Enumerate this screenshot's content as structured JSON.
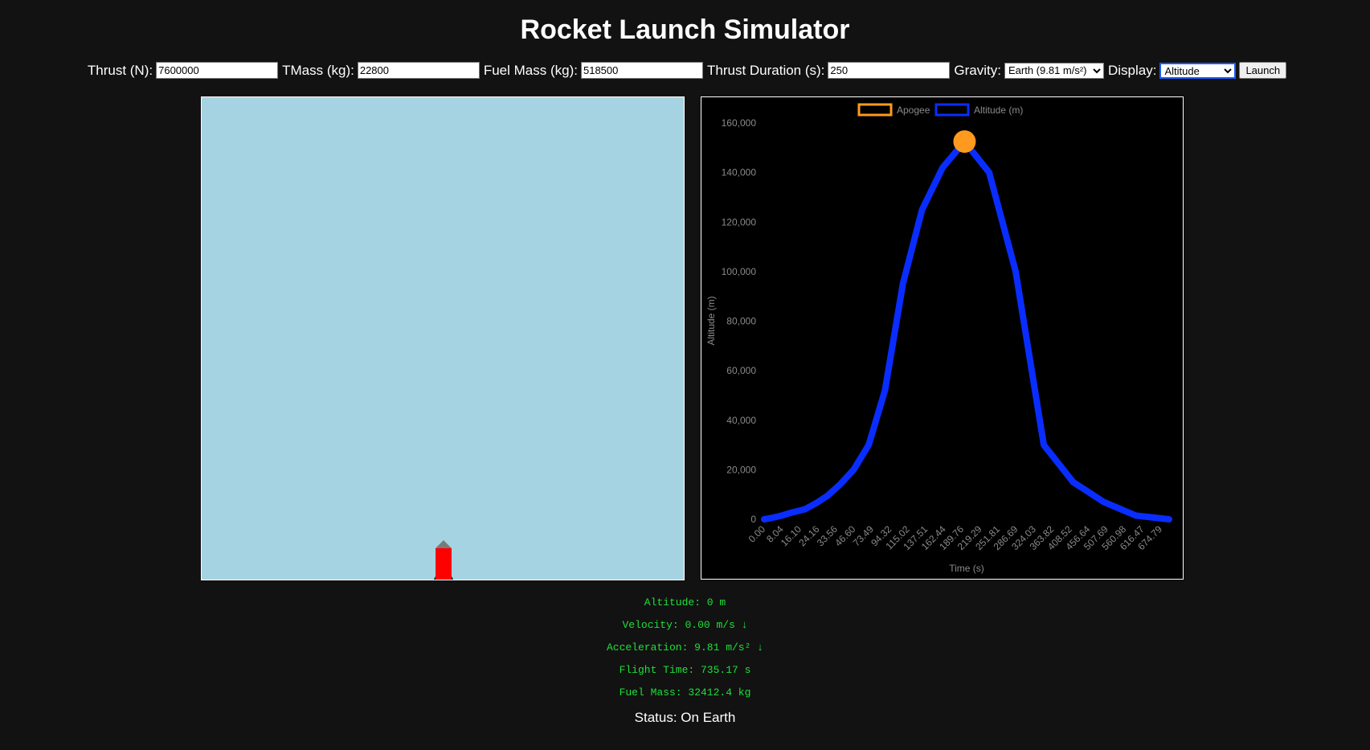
{
  "title": "Rocket Launch Simulator",
  "controls": {
    "thrust_label": "Thrust (N):",
    "thrust_value": "7600000",
    "tmass_label": "TMass (kg):",
    "tmass_value": "22800",
    "fuel_label": "Fuel Mass (kg):",
    "fuel_value": "518500",
    "duration_label": "Thrust Duration (s):",
    "duration_value": "250",
    "gravity_label": "Gravity:",
    "gravity_value": "Earth (9.81 m/s²)",
    "display_label": "Display:",
    "display_value": "Altitude",
    "launch_label": "Launch"
  },
  "simulation": {
    "background": "#a6d3e2",
    "rocket_body_color": "#ff0000",
    "rocket_nose_color": "#7a7a7a"
  },
  "stats": {
    "altitude": "Altitude: 0 m",
    "velocity": "Velocity: 0.00 m/s ↓",
    "acceleration": "Acceleration: 9.81 m/s² ↓",
    "flight_time": "Flight Time: 735.17 s",
    "fuel_mass": "Fuel Mass: 32412.4 kg"
  },
  "status": "Status: On Earth",
  "chart_data": {
    "type": "line",
    "xlabel": "Time (s)",
    "ylabel": "Altitude (m)",
    "ylim": [
      0,
      160000
    ],
    "yticks": [
      0,
      20000,
      40000,
      60000,
      80000,
      100000,
      120000,
      140000,
      160000
    ],
    "ytick_labels": [
      "0",
      "20,000",
      "40,000",
      "60,000",
      "80,000",
      "100,000",
      "120,000",
      "140,000",
      "160,000"
    ],
    "xtick_labels": [
      "0.00",
      "8.04",
      "16.10",
      "24.16",
      "33.56",
      "46.60",
      "73.49",
      "94.32",
      "115.02",
      "137.51",
      "162.44",
      "189.76",
      "219.29",
      "251.81",
      "286.69",
      "324.03",
      "363.82",
      "408.52",
      "456.64",
      "507.69",
      "560.98",
      "616.47",
      "674.79"
    ],
    "grid": false,
    "legend_position": "top",
    "series": [
      {
        "name": "Apogee",
        "color": "#ff9a1f",
        "type": "point",
        "points": [
          {
            "x": 363.82,
            "y": 152500
          }
        ]
      },
      {
        "name": "Altitude (m)",
        "color": "#0a2dff",
        "type": "line",
        "points": [
          {
            "x": 0.0,
            "y": 0
          },
          {
            "x": 8.04,
            "y": 300
          },
          {
            "x": 16.1,
            "y": 700
          },
          {
            "x": 24.16,
            "y": 1100
          },
          {
            "x": 33.56,
            "y": 1600
          },
          {
            "x": 46.6,
            "y": 2500
          },
          {
            "x": 73.49,
            "y": 4000
          },
          {
            "x": 94.32,
            "y": 6500
          },
          {
            "x": 115.02,
            "y": 9500
          },
          {
            "x": 137.51,
            "y": 14000
          },
          {
            "x": 162.44,
            "y": 20000
          },
          {
            "x": 189.76,
            "y": 30000
          },
          {
            "x": 219.29,
            "y": 52000
          },
          {
            "x": 251.81,
            "y": 95000
          },
          {
            "x": 286.69,
            "y": 125000
          },
          {
            "x": 324.03,
            "y": 142000
          },
          {
            "x": 363.82,
            "y": 152500
          },
          {
            "x": 408.52,
            "y": 140000
          },
          {
            "x": 456.64,
            "y": 100000
          },
          {
            "x": 507.69,
            "y": 30000
          },
          {
            "x": 560.98,
            "y": 15000
          },
          {
            "x": 616.47,
            "y": 7000
          },
          {
            "x": 674.79,
            "y": 1500
          },
          {
            "x": 735.17,
            "y": 0
          }
        ]
      }
    ]
  }
}
